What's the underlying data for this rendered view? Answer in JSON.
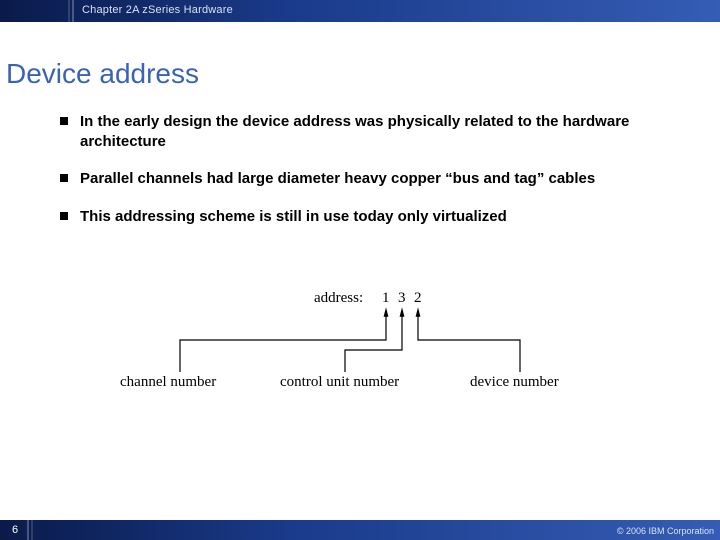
{
  "header": {
    "chapter": "Chapter 2A zSeries Hardware"
  },
  "title": "Device address",
  "bullets": [
    "In the early design the device address was physically related to the hardware architecture",
    "Parallel channels had large diameter heavy copper “bus and tag” cables",
    "This addressing scheme is still in use today only virtualized"
  ],
  "diagram": {
    "address_label": "address:",
    "digits": [
      "1",
      "3",
      "2"
    ],
    "labels": [
      "channel number",
      "control unit number",
      "device number"
    ]
  },
  "footer": {
    "page": "6",
    "copyright": "© 2006 IBM Corporation"
  }
}
